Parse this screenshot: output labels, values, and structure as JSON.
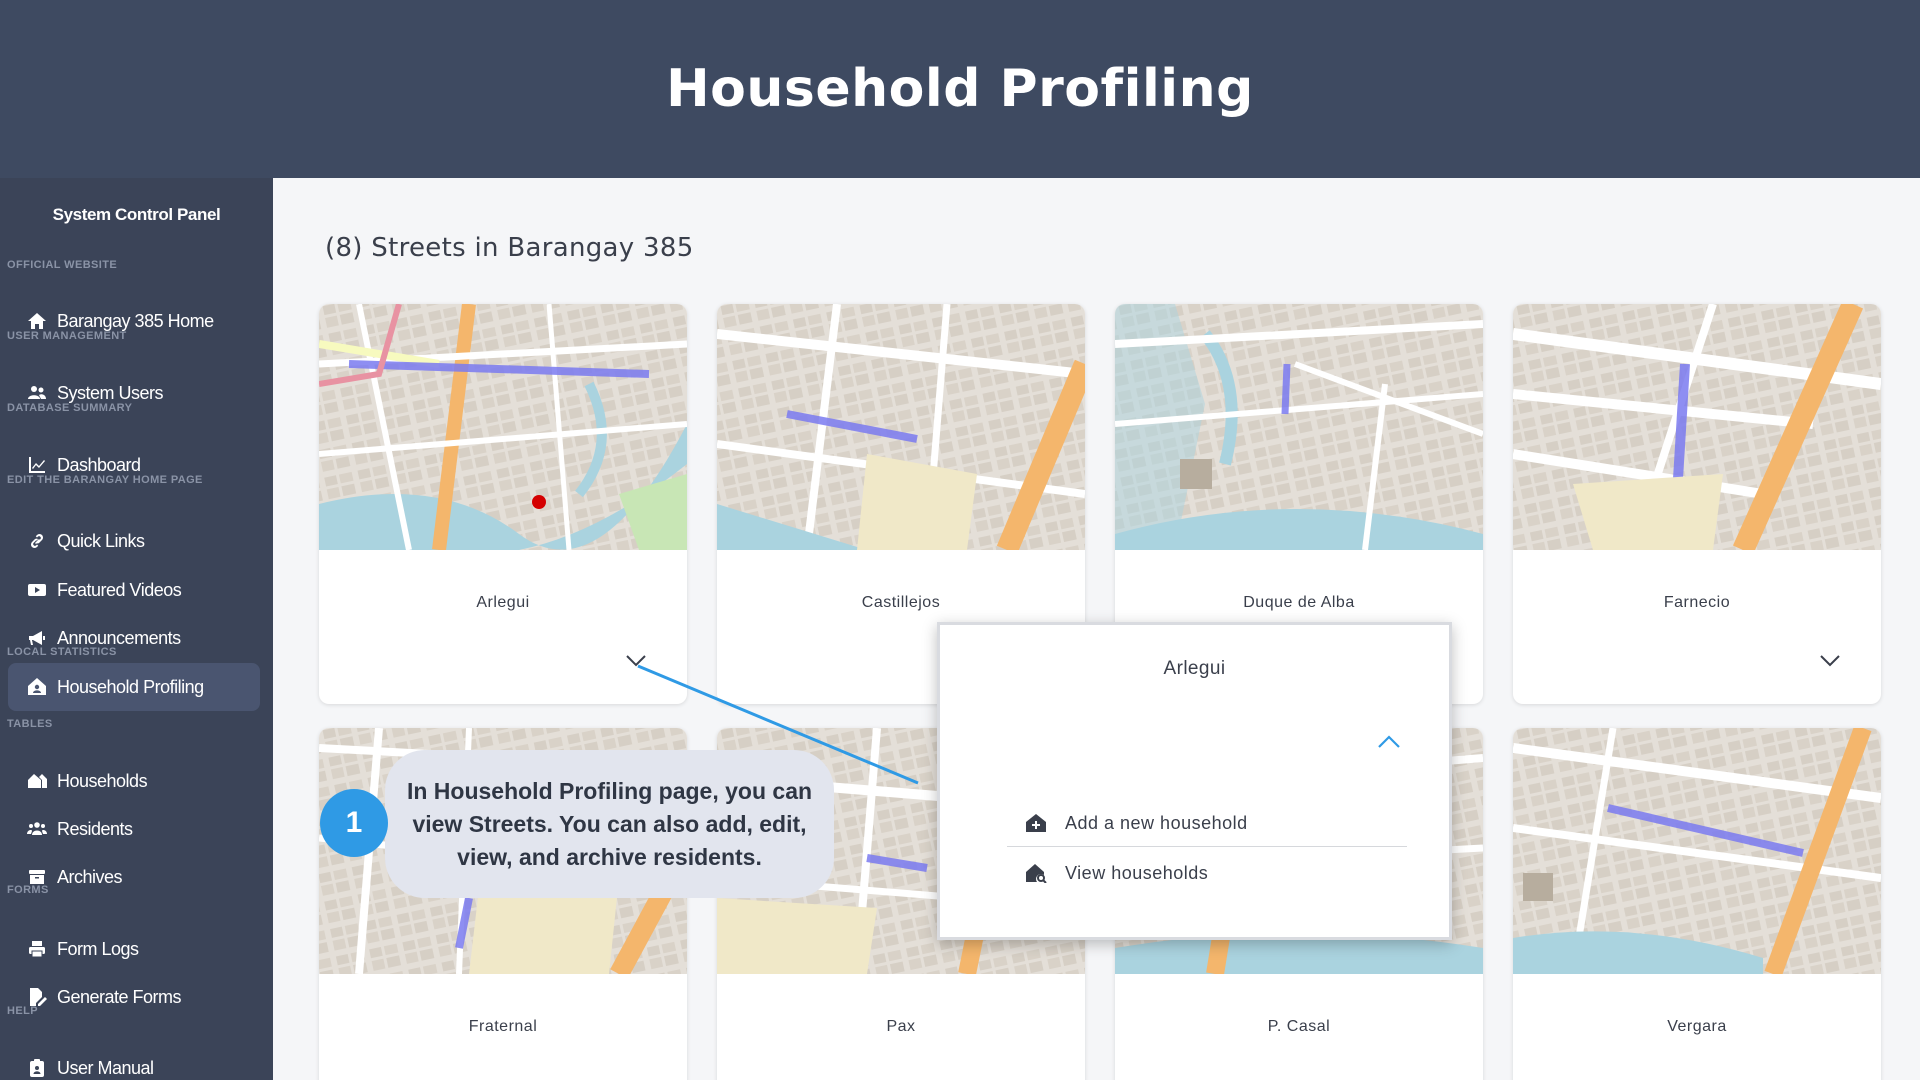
{
  "banner": {
    "title": "Household Profiling"
  },
  "sidebar": {
    "panel_title": "System Control Panel",
    "sections": {
      "official_website": "OFFICIAL WEBSITE",
      "user_management": "USER MANAGEMENT",
      "database_summary": "DATABASE SUMMARY",
      "edit_home": "EDIT THE BARANGAY HOME PAGE",
      "local_statistics": "LOCAL STATISTICS",
      "tables": "TABLES",
      "forms": "FORMS",
      "help": "HELP"
    },
    "items": {
      "home": "Barangay 385 Home",
      "system_users": "System Users",
      "dashboard": "Dashboard",
      "quick_links": "Quick Links",
      "featured_videos": "Featured Videos",
      "announcements": "Announcements",
      "household_profiling": "Household Profiling",
      "households": "Households",
      "residents": "Residents",
      "archives": "Archives",
      "form_logs": "Form Logs",
      "generate_forms": "Generate Forms",
      "user_manual": "User Manual"
    }
  },
  "main": {
    "heading": "(8) Streets in Barangay 385",
    "streets": {
      "arlegui": "Arlegui",
      "castillejos": "Castillejos",
      "duque_de_alba": "Duque de Alba",
      "farnecio": "Farnecio",
      "fraternal": "Fraternal",
      "pax": "Pax",
      "p_casal": "P. Casal",
      "vergara": "Vergara"
    }
  },
  "dropdown": {
    "title": "Arlegui",
    "add_household": "Add a new household",
    "view_households": "View households"
  },
  "tutorial": {
    "step": "1",
    "text": "In Household Profiling page, you can view Streets. You can also add, edit, view, and archive residents."
  },
  "colors": {
    "banner": "#3e4a61",
    "sidebar": "#3b4458",
    "accent": "#2f9ae5",
    "map_water": "#aad3df",
    "map_road": "#f7fabf",
    "map_major": "#f4b66c",
    "map_route": "#7b7bf0"
  }
}
